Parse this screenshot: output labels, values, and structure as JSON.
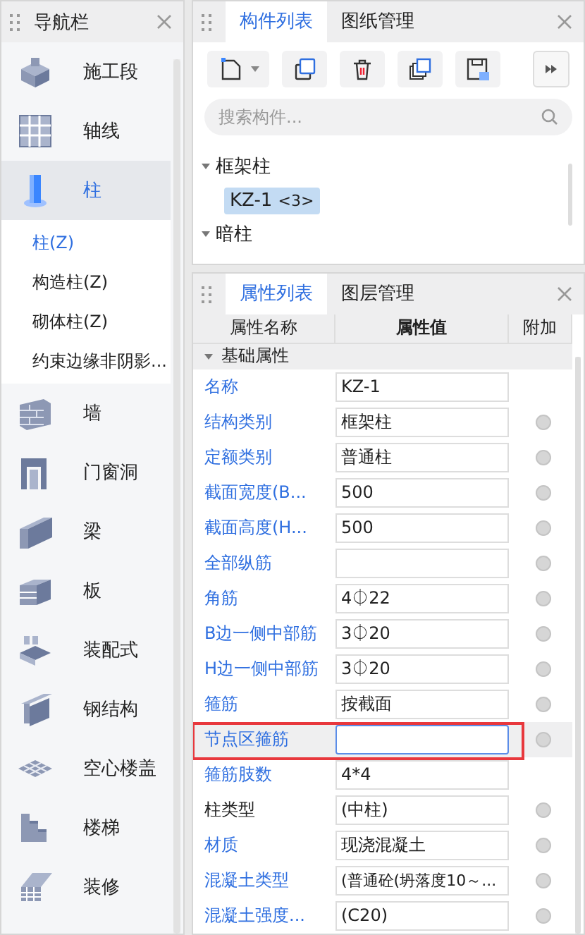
{
  "nav_panel": {
    "title": "导航栏",
    "items": [
      {
        "label": "施工段",
        "selected": false
      },
      {
        "label": "轴线",
        "selected": false
      },
      {
        "label": "柱",
        "selected": true,
        "children": [
          {
            "label": "柱(Z)",
            "selected": true
          },
          {
            "label": "构造柱(Z)",
            "selected": false
          },
          {
            "label": "砌体柱(Z)",
            "selected": false
          },
          {
            "label": "约束边缘非阴影...",
            "selected": false
          }
        ]
      },
      {
        "label": "墙",
        "selected": false
      },
      {
        "label": "门窗洞",
        "selected": false
      },
      {
        "label": "梁",
        "selected": false
      },
      {
        "label": "板",
        "selected": false
      },
      {
        "label": "装配式",
        "selected": false
      },
      {
        "label": "钢结构",
        "selected": false
      },
      {
        "label": "空心楼盖",
        "selected": false
      },
      {
        "label": "楼梯",
        "selected": false
      },
      {
        "label": "装修",
        "selected": false
      }
    ]
  },
  "component_panel": {
    "tabs": [
      {
        "label": "构件列表",
        "selected": true
      },
      {
        "label": "图纸管理",
        "selected": false
      }
    ],
    "search": {
      "placeholder": "搜索构件..."
    },
    "tree": [
      {
        "label": "框架柱",
        "expanded": true,
        "children": [
          {
            "label": "KZ-1",
            "count": "<3>",
            "selected": true
          }
        ]
      },
      {
        "label": "暗柱",
        "expanded": true
      }
    ]
  },
  "property_panel": {
    "tabs": [
      {
        "label": "属性列表",
        "selected": true
      },
      {
        "label": "图层管理",
        "selected": false
      }
    ],
    "columns": [
      "属性名称",
      "属性值",
      "附加"
    ],
    "group": {
      "label": "基础属性",
      "expanded": true
    },
    "rows": [
      {
        "name": "名称",
        "value": "KZ-1",
        "color": "#2f6fe0",
        "attach": false,
        "selected": false,
        "highlighted": false
      },
      {
        "name": "结构类别",
        "value": "框架柱",
        "color": "#2f6fe0",
        "attach": true,
        "selected": false,
        "highlighted": false
      },
      {
        "name": "定额类别",
        "value": "普通柱",
        "color": "#2f6fe0",
        "attach": true,
        "selected": false,
        "highlighted": false
      },
      {
        "name": "截面宽度(B...",
        "value": "500",
        "color": "#2f6fe0",
        "attach": true,
        "selected": false,
        "highlighted": false
      },
      {
        "name": "截面高度(H...",
        "value": "500",
        "color": "#2f6fe0",
        "attach": true,
        "selected": false,
        "highlighted": false
      },
      {
        "name": "全部纵筋",
        "value": "",
        "color": "#2f6fe0",
        "attach": true,
        "selected": false,
        "highlighted": false
      },
      {
        "name": "角筋",
        "value": "4⏀22",
        "color": "#2f6fe0",
        "attach": true,
        "selected": false,
        "highlighted": false
      },
      {
        "name": "B边一侧中部筋",
        "value": "3⏀20",
        "color": "#2f6fe0",
        "attach": true,
        "selected": false,
        "highlighted": false
      },
      {
        "name": "H边一侧中部筋",
        "value": "3⏀20",
        "color": "#2f6fe0",
        "attach": true,
        "selected": false,
        "highlighted": false
      },
      {
        "name": "箍筋",
        "value": "按截面",
        "color": "#2f6fe0",
        "attach": true,
        "selected": false,
        "highlighted": false
      },
      {
        "name": "节点区箍筋",
        "value": "",
        "color": "#2f6fe0",
        "attach": true,
        "selected": true,
        "highlighted": true
      },
      {
        "name": "箍筋肢数",
        "value": "4*4",
        "color": "#2f6fe0",
        "attach": false,
        "selected": false,
        "highlighted": false
      },
      {
        "name": "柱类型",
        "value": "(中柱)",
        "color": "#222222",
        "attach": true,
        "selected": false,
        "highlighted": false
      },
      {
        "name": "材质",
        "value": "现浇混凝土",
        "color": "#2f6fe0",
        "attach": true,
        "selected": false,
        "highlighted": false
      },
      {
        "name": "混凝土类型",
        "value": "(普通砼(坍落度10～...",
        "color": "#2f6fe0",
        "attach": true,
        "selected": false,
        "highlighted": false
      },
      {
        "name": "混凝土强度...",
        "value": "(C20)",
        "color": "#2f6fe0",
        "attach": true,
        "selected": false,
        "highlighted": false
      }
    ]
  }
}
